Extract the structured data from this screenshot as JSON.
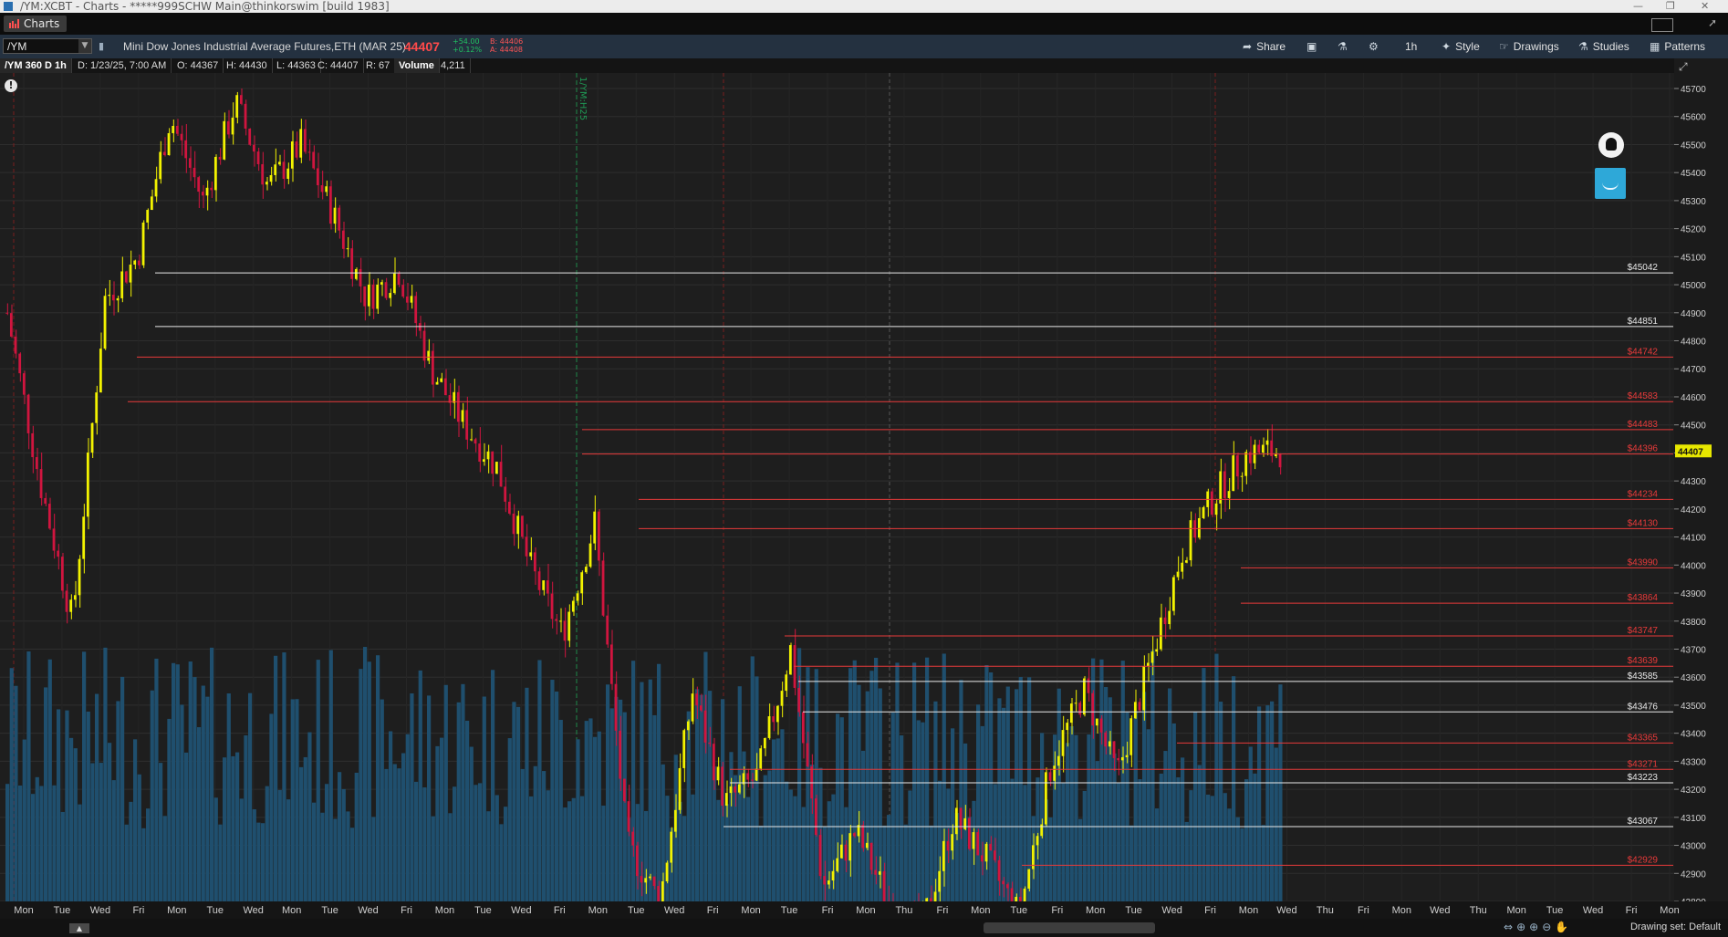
{
  "window": {
    "title": "/YM:XCBT - Charts - *****999SCHW Main@thinkorswim [build 1983]"
  },
  "tab": {
    "label": "Charts"
  },
  "toolbar": {
    "symbol": "/YM",
    "description": "Mini Dow Jones Industrial Average Futures,ETH (MAR 25)",
    "last_price": "44407",
    "change": "+54.00",
    "change_pct": "+0.12%",
    "bid": "B: 44406",
    "ask": "A: 44408",
    "share_label": "Share",
    "timeframe_label": "1h",
    "style_label": "Style",
    "drawings_label": "Drawings",
    "studies_label": "Studies",
    "patterns_label": "Patterns"
  },
  "infobar": {
    "period": "/YM 360 D 1h",
    "date": "D: 1/23/25, 7:00 AM",
    "open": "O: 44367",
    "high": "H: 44430",
    "low": "L: 44363",
    "close": "C: 44407",
    "range": "R: 67",
    "volume_label": "Volume",
    "volume_value": "4,211"
  },
  "footer": {
    "drawing_set": "Drawing set: Default"
  },
  "colors": {
    "up": "#f2f200",
    "down": "#d0153f",
    "volume": "#1f4f6e",
    "level_red": "#e83a3a",
    "level_white": "#e8e8e8",
    "price_tag": "#e8e800"
  },
  "chart_data": {
    "type": "candlestick",
    "y_axis": {
      "min": 42800,
      "max": 45700,
      "step": 100
    },
    "y_tick_labels": [
      "45700",
      "45600",
      "45500",
      "45400",
      "45300",
      "45200",
      "45100",
      "45000",
      "44900",
      "44800",
      "44700",
      "44600",
      "44500",
      "44400",
      "44300",
      "44200",
      "44100",
      "44000",
      "43900",
      "43800",
      "43700",
      "43600",
      "43500",
      "43400",
      "43300",
      "43200",
      "43100",
      "43000",
      "42900",
      "42800"
    ],
    "x_tick_labels": [
      "Mon",
      "Tue",
      "Wed",
      "Fri",
      "Mon",
      "Tue",
      "Wed",
      "Mon",
      "Tue",
      "Wed",
      "Fri",
      "Mon",
      "Tue",
      "Wed",
      "Fri",
      "Mon",
      "Tue",
      "Wed",
      "Fri",
      "Mon",
      "Tue",
      "Fri",
      "Mon",
      "Thu",
      "Fri",
      "Mon",
      "Tue",
      "Fri",
      "Mon",
      "Tue",
      "Wed",
      "Fri",
      "Mon",
      "Wed",
      "Thu",
      "Fri",
      "Mon",
      "Wed",
      "Thu",
      "Mon",
      "Tue",
      "Wed",
      "Fri",
      "Mon"
    ],
    "current_price": "44407",
    "event_marker": "1/YM:H25",
    "levels": [
      {
        "price": 45042,
        "label": "$45042",
        "color": "white"
      },
      {
        "price": 44851,
        "label": "$44851",
        "color": "white"
      },
      {
        "price": 44742,
        "label": "$44742",
        "color": "red"
      },
      {
        "price": 44583,
        "label": "$44583",
        "color": "red"
      },
      {
        "price": 44483,
        "label": "$44483",
        "color": "red"
      },
      {
        "price": 44396,
        "label": "$44396",
        "color": "red"
      },
      {
        "price": 44234,
        "label": "$44234",
        "color": "red"
      },
      {
        "price": 44130,
        "label": "$44130",
        "color": "red"
      },
      {
        "price": 43990,
        "label": "$43990",
        "color": "red"
      },
      {
        "price": 43864,
        "label": "$43864",
        "color": "red"
      },
      {
        "price": 43747,
        "label": "$43747",
        "color": "red"
      },
      {
        "price": 43639,
        "label": "$43639",
        "color": "red"
      },
      {
        "price": 43585,
        "label": "$43585",
        "color": "white"
      },
      {
        "price": 43476,
        "label": "$43476",
        "color": "white"
      },
      {
        "price": 43365,
        "label": "$43365",
        "color": "red"
      },
      {
        "price": 43271,
        "label": "$43271",
        "color": "red"
      },
      {
        "price": 43223,
        "label": "$43223",
        "color": "white"
      },
      {
        "price": 43067,
        "label": "$43067",
        "color": "white"
      },
      {
        "price": 42929,
        "label": "$42929",
        "color": "red"
      }
    ],
    "price_path": [
      44900,
      44300,
      43800,
      44950,
      45100,
      45600,
      45300,
      45650,
      45350,
      45500,
      45250,
      44950,
      45050,
      44700,
      44500,
      44350,
      44000,
      43750,
      44150,
      43000,
      42800,
      43550,
      43150,
      43250,
      43700,
      42850,
      43050,
      42800,
      42700,
      43100,
      42950,
      42750,
      43300,
      43550,
      43250,
      43650,
      44050,
      44250,
      44400,
      44407
    ],
    "vertical_markers": [
      "Wed",
      "Mon",
      "Wed"
    ]
  }
}
